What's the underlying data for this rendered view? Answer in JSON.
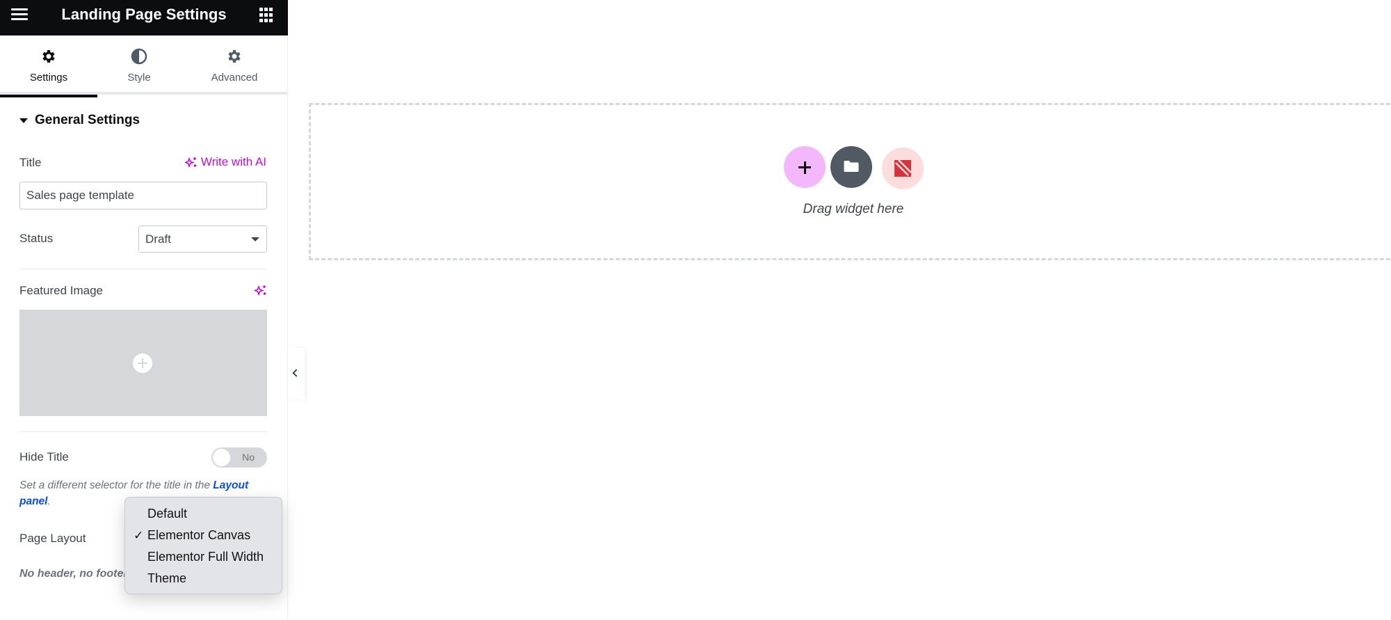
{
  "header": {
    "title": "Landing Page Settings",
    "menu_icon": "hamburger-icon",
    "apps_icon": "grid-icon"
  },
  "tabs": [
    {
      "label": "Settings",
      "icon": "gear-icon",
      "active": true
    },
    {
      "label": "Style",
      "icon": "half-circle-icon",
      "active": false
    },
    {
      "label": "Advanced",
      "icon": "gear-icon",
      "active": false
    }
  ],
  "general": {
    "heading": "General Settings",
    "title_label": "Title",
    "write_ai_label": "Write with AI",
    "title_value": "Sales page template",
    "status_label": "Status",
    "status_value": "Draft",
    "featured_image_label": "Featured Image",
    "hide_title_label": "Hide Title",
    "hide_title_toggle": "No",
    "help_text": "Set a different selector for the title in the ",
    "help_link": "Layout panel",
    "help_suffix": ".",
    "page_layout_label": "Page Layout",
    "page_layout_note": "No header, no footer,"
  },
  "layout_menu": {
    "options": [
      "Default",
      "Elementor Canvas",
      "Elementor Full Width",
      "Theme"
    ],
    "selected": "Elementor Canvas",
    "check_mark": "✓"
  },
  "canvas": {
    "drag_text": "Drag widget here",
    "buttons": [
      "add-section",
      "template-library",
      "kit-library"
    ]
  },
  "colors": {
    "accent_ai": "#c00bd6",
    "link": "#0a4cdb",
    "header_bg": "#0c0d0e"
  }
}
